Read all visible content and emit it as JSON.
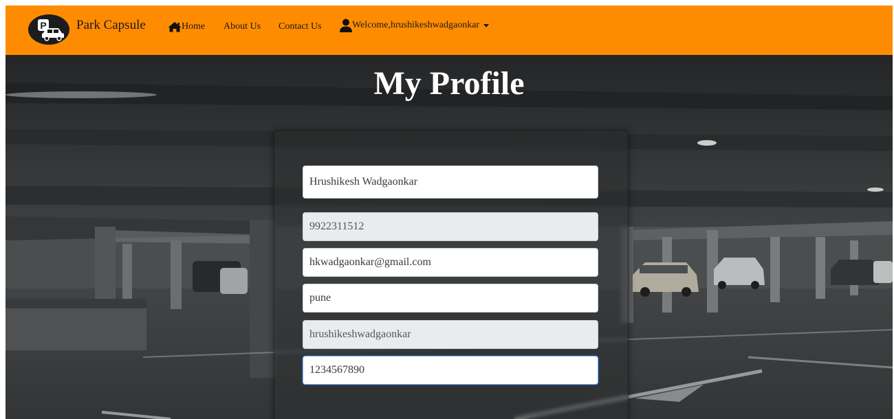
{
  "navbar": {
    "brand": "Park Capsule",
    "logo_icon": "parking-car-logo-icon",
    "home_label": "Home",
    "about_label": "About Us",
    "contact_label": "Contact Us",
    "user_label": "Welcome,hrushikeshwadgaonkar",
    "background_color": "#ff8c00"
  },
  "page": {
    "title": "My Profile"
  },
  "profile_form": {
    "full_name": "Hrushikesh Wadgaonkar",
    "phone": "9922311512",
    "email": "hkwadgaonkar@gmail.com",
    "city": "pune",
    "username": "hrushikeshwadgaonkar",
    "password": "1234567890"
  }
}
